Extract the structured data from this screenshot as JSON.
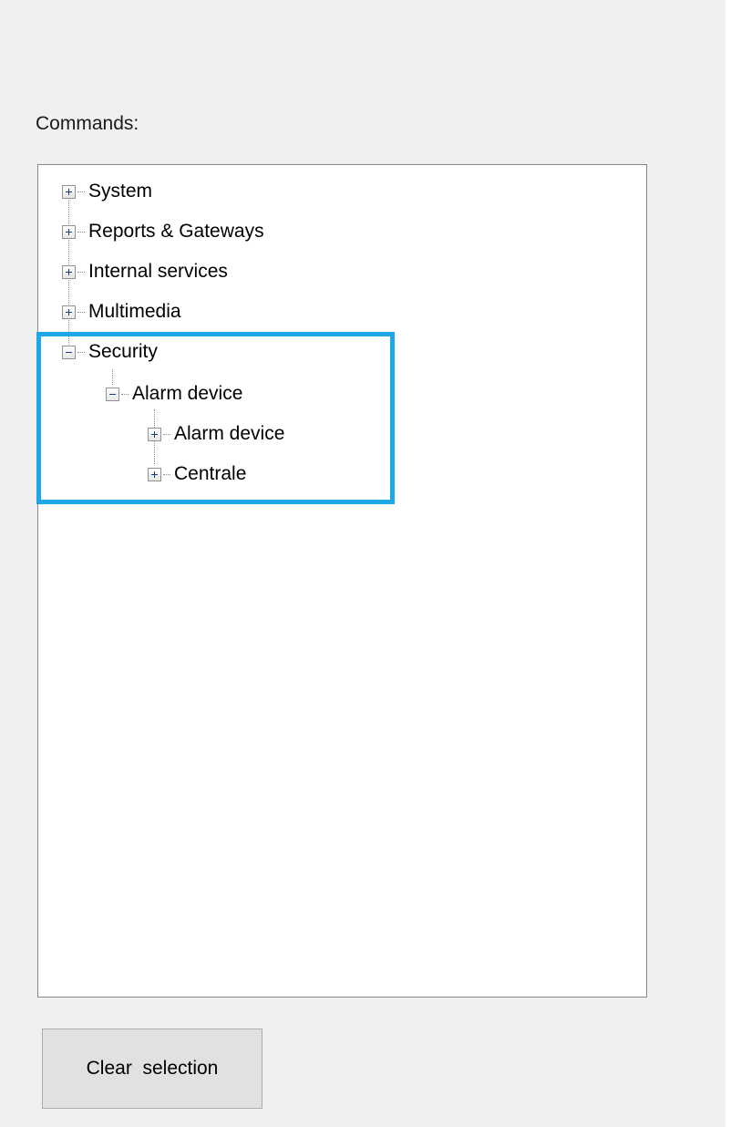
{
  "commands_label": "Commands:",
  "tree": {
    "nodes": [
      {
        "label": "System",
        "state": "collapsed",
        "level": 0
      },
      {
        "label": "Reports & Gateways",
        "state": "collapsed",
        "level": 0
      },
      {
        "label": "Internal services",
        "state": "collapsed",
        "level": 0
      },
      {
        "label": "Multimedia",
        "state": "collapsed",
        "level": 0
      },
      {
        "label": "Security",
        "state": "expanded",
        "level": 0
      },
      {
        "label": "Alarm device",
        "state": "expanded",
        "level": 1
      },
      {
        "label": "Alarm device",
        "state": "collapsed",
        "level": 2
      },
      {
        "label": "Centrale",
        "state": "collapsed",
        "level": 2
      }
    ]
  },
  "clear_button_label": "Clear  selection",
  "colors": {
    "highlight": "#1ea7e7",
    "background": "#f0f0f0",
    "tree_background": "#ffffff",
    "button_background": "#e1e1e1"
  },
  "icons": {
    "expand": "plus-box-icon",
    "collapse": "minus-box-icon"
  }
}
